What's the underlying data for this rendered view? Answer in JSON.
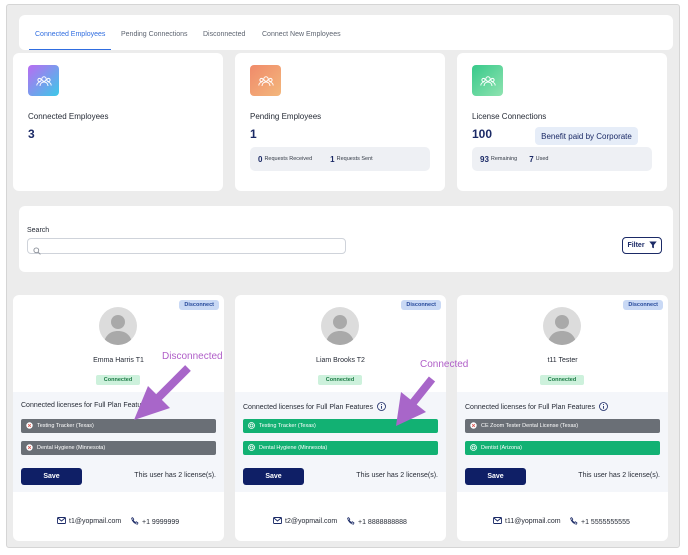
{
  "tabs": [
    {
      "label": "Connected Employees",
      "active": true
    },
    {
      "label": "Pending Connections",
      "active": false
    },
    {
      "label": "Disconnected",
      "active": false
    },
    {
      "label": "Connect New Employees",
      "active": false
    }
  ],
  "stats": {
    "connected": {
      "title": "Connected Employees",
      "value": "3"
    },
    "pending": {
      "title": "Pending Employees",
      "value": "1",
      "received_num": "0",
      "received_label": "Requests Received",
      "sent_num": "1",
      "sent_label": "Requests Sent"
    },
    "license": {
      "title": "License Connections",
      "value": "100",
      "benefit": "Benefit paid by Corporate",
      "remaining_num": "93",
      "remaining_label": "Remaining",
      "used_num": "7",
      "used_label": "Used"
    }
  },
  "search": {
    "label": "Search",
    "value": "",
    "placeholder": "",
    "filter_label": "Filter"
  },
  "employees": [
    {
      "name": "Emma Harris T1",
      "status": "Connected",
      "disconnect_label": "Disconnect",
      "licenses_title": "Connected licenses for Full Plan Features",
      "licenses": [
        {
          "name": "Testing Tracker (Texas)",
          "state": "off"
        },
        {
          "name": "Dental Hygiene (Minnesota)",
          "state": "off"
        }
      ],
      "save_label": "Save",
      "license_count": "This user has 2 license(s).",
      "email": "t1@yopmail.com",
      "phone": "+1 9999999"
    },
    {
      "name": "Liam Brooks T2",
      "status": "Connected",
      "disconnect_label": "Disconnect",
      "licenses_title": "Connected licenses for Full Plan Features",
      "licenses": [
        {
          "name": "Testing Tracker (Texas)",
          "state": "on"
        },
        {
          "name": "Dental Hygiene (Minnesota)",
          "state": "on"
        }
      ],
      "save_label": "Save",
      "license_count": "This user has 2 license(s).",
      "email": "t2@yopmail.com",
      "phone": "+1 8888888888"
    },
    {
      "name": "t11 Tester",
      "status": "Connected",
      "disconnect_label": "Disconnect",
      "licenses_title": "Connected licenses for Full Plan Features",
      "licenses": [
        {
          "name": "CE Zoom Tester Dental License (Texas)",
          "state": "off"
        },
        {
          "name": "Dentist (Arizona)",
          "state": "on"
        }
      ],
      "save_label": "Save",
      "license_count": "This user has 2 license(s).",
      "email": "t11@yopmail.com",
      "phone": "+1 5555555555"
    }
  ],
  "annotations": {
    "disconnected": "Disconnected",
    "connected": "Connected"
  },
  "colors": {
    "accent": "#2f6de0",
    "navy": "#0f1f66",
    "green": "#12b173",
    "grey": "#6a6f76",
    "annotation": "#b05ec8"
  },
  "icons": {
    "stat": "people-icon",
    "search": "search-icon",
    "filter": "funnel-icon",
    "license_off": "x-circle-icon",
    "license_on": "check-circle-icon",
    "email": "envelope-icon",
    "phone": "phone-icon",
    "info": "info-icon"
  }
}
